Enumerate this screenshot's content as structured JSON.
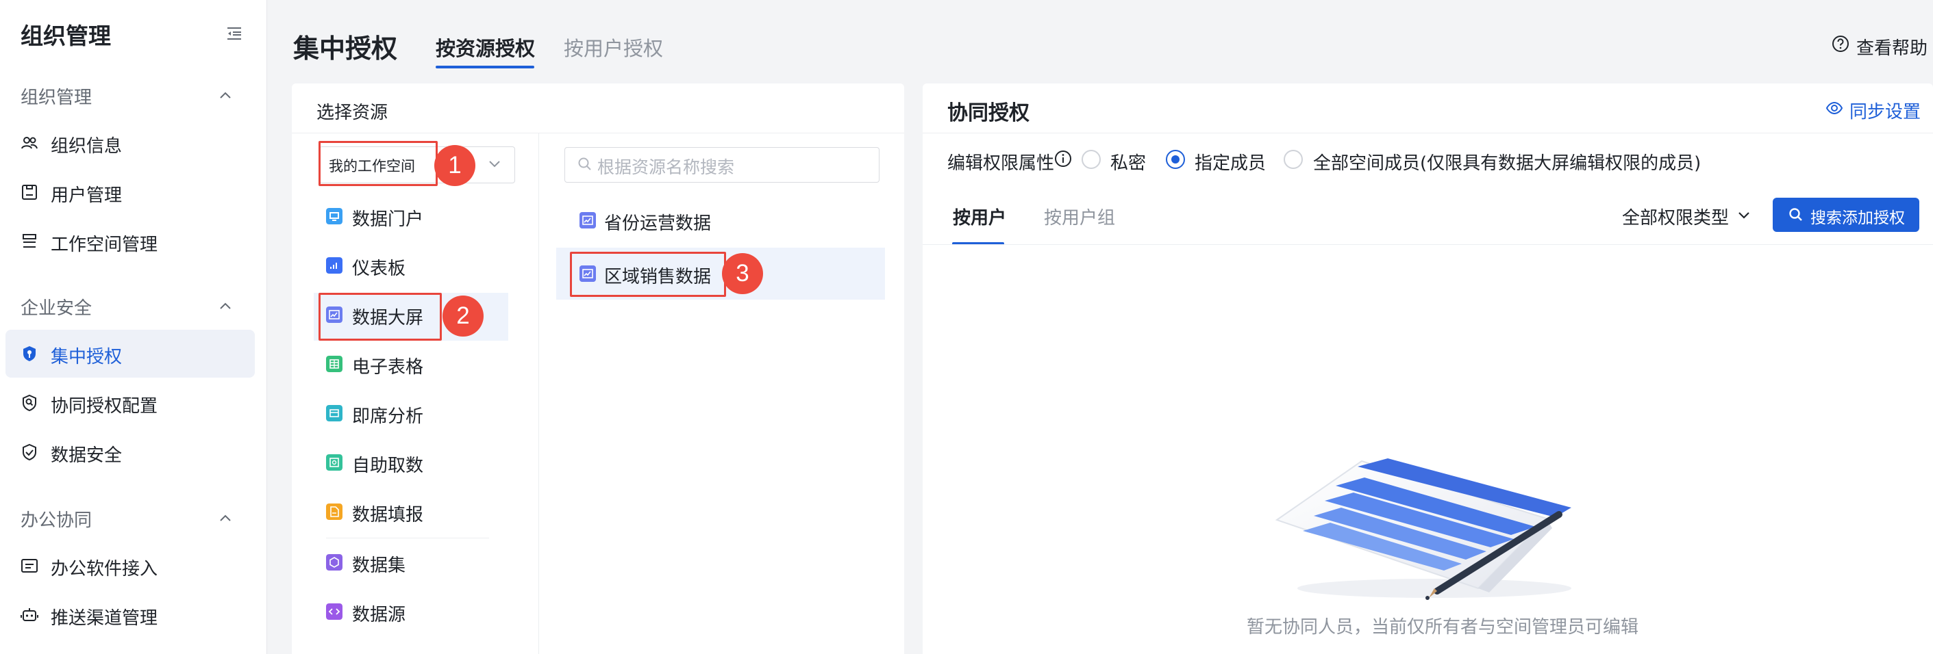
{
  "sidebar": {
    "title": "组织管理",
    "sections": [
      {
        "title": "组织管理",
        "items": [
          {
            "label": "组织信息",
            "icon": "team-icon"
          },
          {
            "label": "用户管理",
            "icon": "user-card-icon"
          },
          {
            "label": "工作空间管理",
            "icon": "layers-icon"
          }
        ]
      },
      {
        "title": "企业安全",
        "items": [
          {
            "label": "集中授权",
            "icon": "shield-key-icon",
            "active": true
          },
          {
            "label": "协同授权配置",
            "icon": "search-shield-icon"
          },
          {
            "label": "数据安全",
            "icon": "shield-check-icon"
          }
        ]
      },
      {
        "title": "办公协同",
        "items": [
          {
            "label": "办公软件接入",
            "icon": "app-window-icon"
          },
          {
            "label": "推送渠道管理",
            "icon": "robot-icon"
          }
        ]
      }
    ]
  },
  "header": {
    "title": "集中授权",
    "tabs": [
      {
        "label": "按资源授权",
        "active": true
      },
      {
        "label": "按用户授权",
        "active": false
      }
    ],
    "help_label": "查看帮助"
  },
  "resource_panel": {
    "title": "选择资源",
    "workspace_select": "我的工作空间",
    "resource_types": [
      {
        "label": "数据门户",
        "color": "#3aa0f3"
      },
      {
        "label": "仪表板",
        "color": "#3b6ff5"
      },
      {
        "label": "数据大屏",
        "color": "#6b7cf0",
        "selected": true
      },
      {
        "label": "电子表格",
        "color": "#35c07c"
      },
      {
        "label": "即席分析",
        "color": "#2eb5c9"
      },
      {
        "label": "自助取数",
        "color": "#34c29a"
      },
      {
        "label": "数据填报",
        "color": "#f5a623"
      },
      {
        "label": "数据集",
        "color": "#8a63e6"
      },
      {
        "label": "数据源",
        "color": "#9b59e8"
      }
    ],
    "search_placeholder": "根据资源名称搜索",
    "items": [
      {
        "label": "省份运营数据"
      },
      {
        "label": "区域销售数据",
        "selected": true
      }
    ]
  },
  "annotations": {
    "badges": [
      "1",
      "2",
      "3"
    ],
    "color": "#ee4a3d"
  },
  "collab_panel": {
    "title": "协同授权",
    "sync_label": "同步设置",
    "edit_perm_label": "编辑权限属性",
    "options": [
      {
        "label": "私密",
        "checked": false
      },
      {
        "label": "指定成员",
        "checked": true
      },
      {
        "label": "全部空间成员(仅限具有数据大屏编辑权限的成员)",
        "checked": false
      }
    ],
    "sub_tabs": [
      {
        "label": "按用户",
        "active": true
      },
      {
        "label": "按用户组",
        "active": false
      }
    ],
    "perm_type_filter": "全部权限类型",
    "add_button": "搜索添加授权",
    "empty_text": "暂无协同人员，当前仅所有者与空间管理员可编辑"
  },
  "colors": {
    "accent": "#1e5fd8",
    "annotation_red": "#ee4a3d"
  }
}
